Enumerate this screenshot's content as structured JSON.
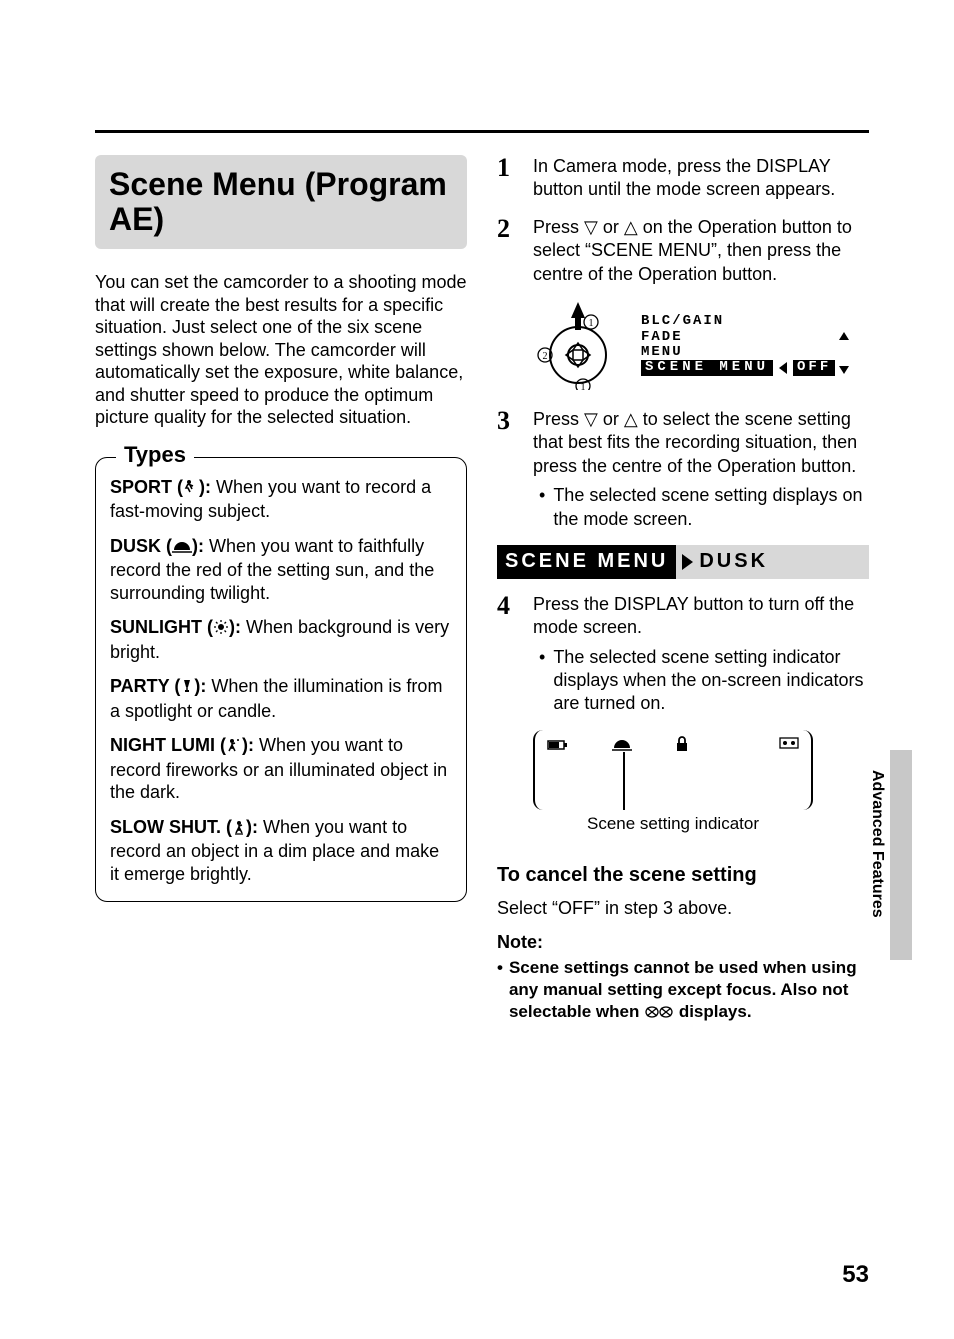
{
  "page_number": "53",
  "side_label": "Advanced Features",
  "title": "Scene Menu (Program AE)",
  "intro": "You can set the camcorder to a shooting mode that will create the best results for a specific situation. Just select one of the six scene settings shown below. The camcorder will automatically set the exposure, white balance, and shutter speed to produce the optimum picture quality for the selected situation.",
  "types_heading": "Types",
  "types": [
    {
      "name": "SPORT (",
      "after": "):",
      "desc": " When you want to record a fast-moving subject."
    },
    {
      "name": "DUSK (",
      "after": "):",
      "desc": " When you want to faithfully record the red of the setting sun, and the surrounding twilight."
    },
    {
      "name": "SUNLIGHT (",
      "after": "):",
      "desc": " When background is very bright."
    },
    {
      "name": "PARTY (",
      "after": "):",
      "desc": " When the illumination is from a spotlight or candle."
    },
    {
      "name": "NIGHT LUMI (",
      "after": "):",
      "desc": " When you want to record fireworks or an illuminated object in the dark."
    },
    {
      "name": "SLOW SHUT. (",
      "after": "):",
      "desc": " When you want to record an object in a dim place and make it emerge brightly."
    }
  ],
  "steps": {
    "s1": "In Camera mode, press the DISPLAY button until the mode screen appears.",
    "s2": "Press  ▽  or  △  on the Operation button to select “SCENE MENU”, then press the centre of the Operation button.",
    "s3": "Press  ▽  or  △  to select the scene setting that best fits the recording situation, then press the centre of the Operation button.",
    "s3_b": "The selected scene setting displays on the mode screen.",
    "s4": "Press the DISPLAY button to turn off the mode screen.",
    "s4_b": "The selected scene setting indicator displays when the on-screen indicators are turned on."
  },
  "osd_menu": {
    "l1": "BLC/GAIN",
    "l2": "FADE",
    "l3": "MENU",
    "sel": "SCENE MENU",
    "val": "OFF"
  },
  "scene_bar": {
    "label": "SCENE MENU",
    "value": "DUSK"
  },
  "indicator_caption": "Scene setting indicator",
  "cancel_h": "To cancel the scene setting",
  "cancel_p": "Select “OFF” in step 3 above.",
  "note_h": "Note:",
  "note_b": "Scene settings cannot be used when using any manual setting except focus. Also not selectable when",
  "note_b2": "displays."
}
